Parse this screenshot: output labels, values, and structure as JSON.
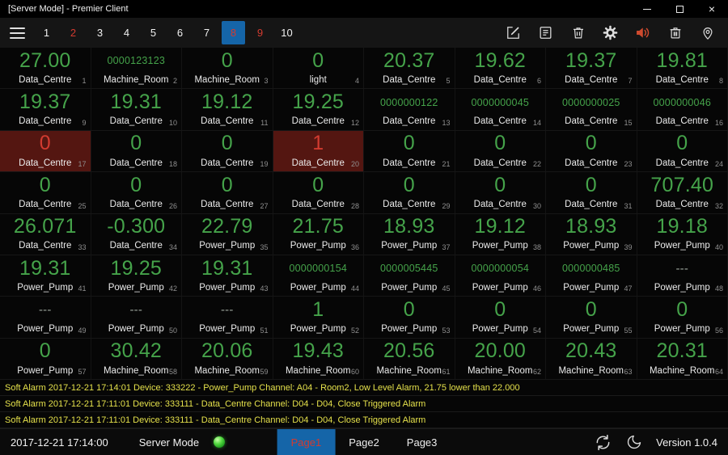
{
  "window": {
    "title": "[Server Mode] - Premier Client",
    "controls": {
      "close": "×"
    }
  },
  "toolbar": {
    "pages": [
      {
        "label": "1"
      },
      {
        "label": "2",
        "alarm": true
      },
      {
        "label": "3"
      },
      {
        "label": "4"
      },
      {
        "label": "5"
      },
      {
        "label": "6"
      },
      {
        "label": "7"
      },
      {
        "label": "8",
        "alarm": true,
        "selected": true
      },
      {
        "label": "9",
        "alarm": true
      },
      {
        "label": "10"
      }
    ],
    "icons": [
      "edit",
      "report",
      "delete",
      "settings",
      "audio-alarm",
      "clear",
      "location"
    ]
  },
  "grid": {
    "columns": 8,
    "cells": [
      {
        "value": "27.00",
        "label": "Data_Centre",
        "index": "1"
      },
      {
        "value": "0000123123",
        "label": "Machine_Room",
        "index": "2",
        "style": "small"
      },
      {
        "value": "0",
        "label": "Machine_Room",
        "index": "3"
      },
      {
        "value": "0",
        "label": "light",
        "index": "4"
      },
      {
        "value": "20.37",
        "label": "Data_Centre",
        "index": "5"
      },
      {
        "value": "19.62",
        "label": "Data_Centre",
        "index": "6"
      },
      {
        "value": "19.37",
        "label": "Data_Centre",
        "index": "7"
      },
      {
        "value": "19.81",
        "label": "Data_Centre",
        "index": "8"
      },
      {
        "value": "19.37",
        "label": "Data_Centre",
        "index": "9"
      },
      {
        "value": "19.31",
        "label": "Data_Centre",
        "index": "10"
      },
      {
        "value": "19.12",
        "label": "Data_Centre",
        "index": "11"
      },
      {
        "value": "19.25",
        "label": "Data_Centre",
        "index": "12"
      },
      {
        "value": "0000000122",
        "label": "Data_Centre",
        "index": "13",
        "style": "small"
      },
      {
        "value": "0000000045",
        "label": "Data_Centre",
        "index": "14",
        "style": "small"
      },
      {
        "value": "0000000025",
        "label": "Data_Centre",
        "index": "15",
        "style": "small"
      },
      {
        "value": "0000000046",
        "label": "Data_Centre",
        "index": "16",
        "style": "small"
      },
      {
        "value": "0",
        "label": "Data_Centre",
        "index": "17",
        "style": "red"
      },
      {
        "value": "0",
        "label": "Data_Centre",
        "index": "18"
      },
      {
        "value": "0",
        "label": "Data_Centre",
        "index": "19"
      },
      {
        "value": "1",
        "label": "Data_Centre",
        "index": "20",
        "style": "red"
      },
      {
        "value": "0",
        "label": "Data_Centre",
        "index": "21"
      },
      {
        "value": "0",
        "label": "Data_Centre",
        "index": "22"
      },
      {
        "value": "0",
        "label": "Data_Centre",
        "index": "23"
      },
      {
        "value": "0",
        "label": "Data_Centre",
        "index": "24"
      },
      {
        "value": "0",
        "label": "Data_Centre",
        "index": "25"
      },
      {
        "value": "0",
        "label": "Data_Centre",
        "index": "26"
      },
      {
        "value": "0",
        "label": "Data_Centre",
        "index": "27"
      },
      {
        "value": "0",
        "label": "Data_Centre",
        "index": "28"
      },
      {
        "value": "0",
        "label": "Data_Centre",
        "index": "29"
      },
      {
        "value": "0",
        "label": "Data_Centre",
        "index": "30"
      },
      {
        "value": "0",
        "label": "Data_Centre",
        "index": "31"
      },
      {
        "value": "707.40",
        "label": "Data_Centre",
        "index": "32"
      },
      {
        "value": "26.071",
        "label": "Data_Centre",
        "index": "33"
      },
      {
        "value": "-0.300",
        "label": "Data_Centre",
        "index": "34"
      },
      {
        "value": "22.79",
        "label": "Power_Pump",
        "index": "35"
      },
      {
        "value": "21.75",
        "label": "Power_Pump",
        "index": "36"
      },
      {
        "value": "18.93",
        "label": "Power_Pump",
        "index": "37"
      },
      {
        "value": "19.12",
        "label": "Power_Pump",
        "index": "38"
      },
      {
        "value": "18.93",
        "label": "Power_Pump",
        "index": "39"
      },
      {
        "value": "19.18",
        "label": "Power_Pump",
        "index": "40"
      },
      {
        "value": "19.31",
        "label": "Power_Pump",
        "index": "41"
      },
      {
        "value": "19.25",
        "label": "Power_Pump",
        "index": "42"
      },
      {
        "value": "19.31",
        "label": "Power_Pump",
        "index": "43"
      },
      {
        "value": "0000000154",
        "label": "Power_Pump",
        "index": "44",
        "style": "small"
      },
      {
        "value": "0000005445",
        "label": "Power_Pump",
        "index": "45",
        "style": "small"
      },
      {
        "value": "0000000054",
        "label": "Power_Pump",
        "index": "46",
        "style": "small"
      },
      {
        "value": "0000000485",
        "label": "Power_Pump",
        "index": "47",
        "style": "small"
      },
      {
        "value": "---",
        "label": "Power_Pump",
        "index": "48",
        "style": "dash"
      },
      {
        "value": "---",
        "label": "Power_Pump",
        "index": "49",
        "style": "dash"
      },
      {
        "value": "---",
        "label": "Power_Pump",
        "index": "50",
        "style": "dash"
      },
      {
        "value": "---",
        "label": "Power_Pump",
        "index": "51",
        "style": "dash"
      },
      {
        "value": "1",
        "label": "Power_Pump",
        "index": "52"
      },
      {
        "value": "0",
        "label": "Power_Pump",
        "index": "53"
      },
      {
        "value": "0",
        "label": "Power_Pump",
        "index": "54"
      },
      {
        "value": "0",
        "label": "Power_Pump",
        "index": "55"
      },
      {
        "value": "0",
        "label": "Power_Pump",
        "index": "56"
      },
      {
        "value": "0",
        "label": "Power_Pump",
        "index": "57"
      },
      {
        "value": "30.42",
        "label": "Machine_Room",
        "index": "58"
      },
      {
        "value": "20.06",
        "label": "Machine_Room",
        "index": "59"
      },
      {
        "value": "19.43",
        "label": "Machine_Room",
        "index": "60"
      },
      {
        "value": "20.56",
        "label": "Machine_Room",
        "index": "61"
      },
      {
        "value": "20.00",
        "label": "Machine_Room",
        "index": "62"
      },
      {
        "value": "20.43",
        "label": "Machine_Room",
        "index": "63"
      },
      {
        "value": "20.31",
        "label": "Machine_Room",
        "index": "64"
      }
    ]
  },
  "alarms": [
    {
      "text": "Soft Alarm 2017-12-21 17:14:01 Device: 333222 - Power_Pump Channel: A04 - Room2, Low Level Alarm, 21.75 lower than 22.000"
    },
    {
      "text": "Soft Alarm 2017-12-21 17:11:01 Device: 333111 - Data_Centre Channel: D04 - D04, Close Triggered Alarm"
    },
    {
      "text": "Soft Alarm 2017-12-21 17:11:01 Device: 333111 - Data_Centre Channel: D04 - D04, Close Triggered Alarm"
    }
  ],
  "statusbar": {
    "datetime": "2017-12-21 17:14:00",
    "mode": "Server Mode",
    "tabs": [
      {
        "label": "Page1",
        "selected": true
      },
      {
        "label": "Page2"
      },
      {
        "label": "Page3"
      }
    ],
    "version": "Version 1.0.4"
  },
  "colors": {
    "green": "#45a34a",
    "red": "#d23b30",
    "alarm_bg": "#541611",
    "yellow": "#e5e14b",
    "blue": "#1565a8"
  }
}
